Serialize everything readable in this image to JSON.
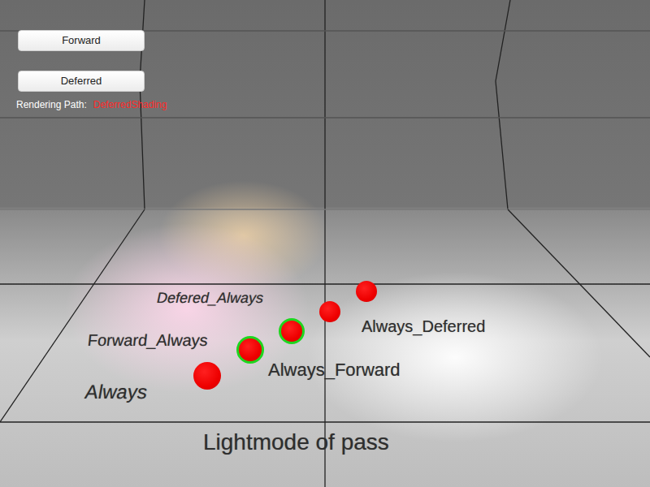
{
  "ui": {
    "buttons": [
      {
        "label": "Forward"
      },
      {
        "label": "Deferred"
      }
    ],
    "rendering_path": {
      "label": "Rendering Path:",
      "value": "DeferredShading"
    }
  },
  "floor_labels": [
    "Defered_Always",
    "Always_Deferred",
    "Forward_Always",
    "Always_Forward",
    "Always",
    "Lightmode of pass"
  ],
  "spheres": [
    {
      "outlined": false
    },
    {
      "outlined": false
    },
    {
      "outlined": true
    },
    {
      "outlined": true
    },
    {
      "outlined": false
    }
  ]
}
